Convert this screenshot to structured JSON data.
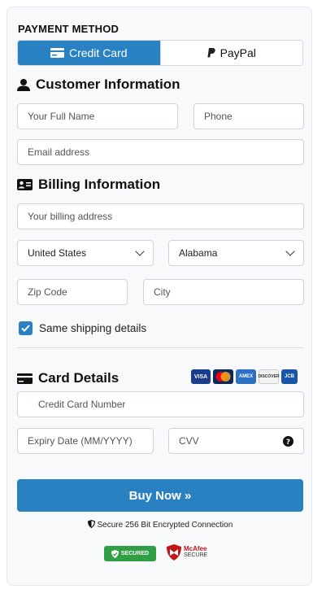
{
  "payment_method": {
    "title": "PAYMENT METHOD",
    "tabs": [
      {
        "label": "Credit Card",
        "active": true
      },
      {
        "label": "PayPal",
        "active": false
      }
    ]
  },
  "customer": {
    "title": "Customer Information",
    "full_name_placeholder": "Your Full Name",
    "phone_placeholder": "Phone",
    "email_placeholder": "Email address"
  },
  "billing": {
    "title": "Billing Information",
    "address_placeholder": "Your billing address",
    "country_value": "United States",
    "state_value": "Alabama",
    "zip_placeholder": "Zip Code",
    "city_placeholder": "City",
    "same_shipping_label": "Same shipping details",
    "same_shipping_checked": true
  },
  "card": {
    "title": "Card Details",
    "badges": [
      "VISA",
      "mastercard",
      "AMEX",
      "DISCOVER",
      "JCB"
    ],
    "number_placeholder": "Credit Card Number",
    "expiry_placeholder": "Expiry Date (MM/YYYY)",
    "cvv_placeholder": "CVV"
  },
  "buy_label": "Buy Now »",
  "secure_text": "Secure 256 Bit Encrypted Connection",
  "seals": {
    "secured": "SECURED",
    "mcafee_top": "McAfee",
    "mcafee_bottom": "SECURE"
  },
  "colors": {
    "accent": "#2a81c2",
    "seal_green": "#2f9e44",
    "mcafee_red": "#c01818"
  }
}
